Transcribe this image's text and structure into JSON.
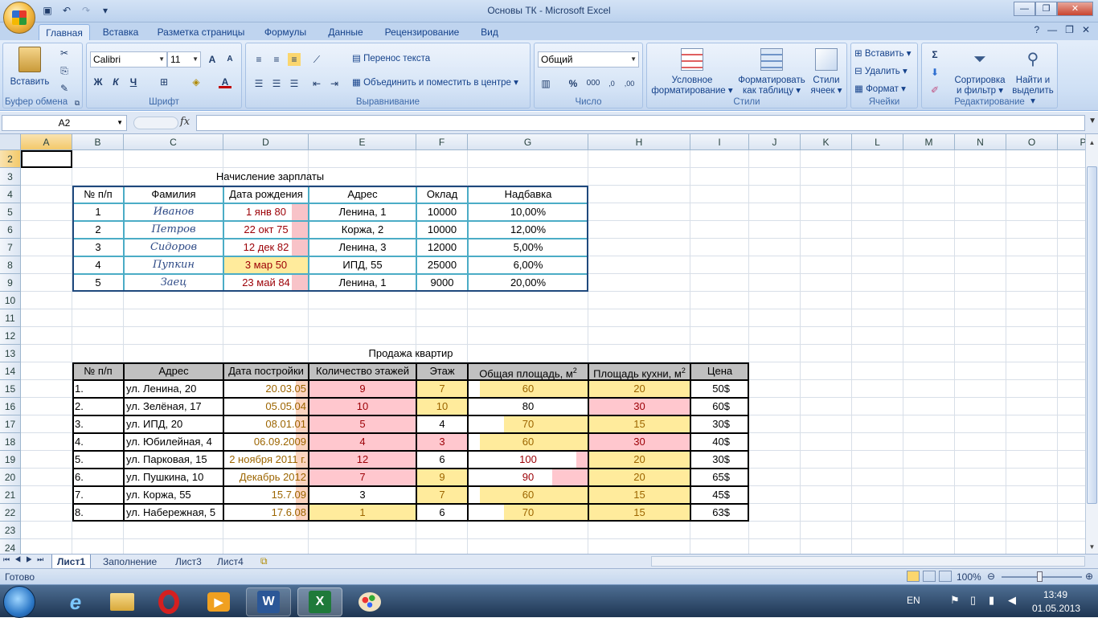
{
  "window": {
    "title": "Основы ТК - Microsoft Excel"
  },
  "tabs": [
    "Главная",
    "Вставка",
    "Разметка страницы",
    "Формулы",
    "Данные",
    "Рецензирование",
    "Вид"
  ],
  "ribbon": {
    "clipboard": {
      "label": "Буфер обмена",
      "paste": "Вставить"
    },
    "font": {
      "label": "Шрифт",
      "name": "Calibri",
      "size": "11"
    },
    "alignment": {
      "label": "Выравнивание",
      "wrap": "Перенос текста",
      "merge": "Объединить и поместить в центре"
    },
    "number": {
      "label": "Число",
      "format": "Общий"
    },
    "styles": {
      "label": "Стили",
      "cond1": "Условное",
      "cond2": "форматирование",
      "fmt1": "Форматировать",
      "fmt2": "как таблицу",
      "cell1": "Стили",
      "cell2": "ячеек"
    },
    "cells": {
      "label": "Ячейки",
      "insert": "Вставить",
      "delete": "Удалить",
      "format": "Формат"
    },
    "editing": {
      "label": "Редактирование",
      "sort1": "Сортировка",
      "sort2": "и фильтр",
      "find1": "Найти и",
      "find2": "выделить"
    }
  },
  "formula_bar": {
    "name_box": "A2",
    "fx": "fx",
    "formula": ""
  },
  "columns": [
    "A",
    "B",
    "C",
    "D",
    "E",
    "F",
    "G",
    "H",
    "I",
    "J",
    "K",
    "L",
    "M",
    "N",
    "O",
    "P"
  ],
  "rows": [
    "2",
    "3",
    "4",
    "5",
    "6",
    "7",
    "8",
    "9",
    "10",
    "11",
    "12",
    "13",
    "14",
    "15",
    "16",
    "17",
    "18",
    "19",
    "20",
    "21",
    "22",
    "23",
    "24"
  ],
  "salary": {
    "title": "Начисление зарплаты",
    "headers": [
      "№ п/п",
      "Фамилия",
      "Дата рождения",
      "Адрес",
      "Оклад",
      "Надбавка"
    ],
    "rows": [
      [
        "1",
        "Иванов",
        "1 янв 80",
        "Ленина, 1",
        "10000",
        "10,00%"
      ],
      [
        "2",
        "Петров",
        "22 окт 75",
        "Коржа, 2",
        "10000",
        "12,00%"
      ],
      [
        "3",
        "Сидоров",
        "12 дек 82",
        "Ленина, 3",
        "12000",
        "5,00%"
      ],
      [
        "4",
        "Пупкин",
        "3 мар 50",
        "ИПД, 55",
        "25000",
        "6,00%"
      ],
      [
        "5",
        "Заец",
        "23 май 84",
        "Ленина, 1",
        "9000",
        "20,00%"
      ]
    ]
  },
  "sales": {
    "title": "Продажа квартир",
    "headers": [
      "№ п/п",
      "Адрес",
      "Дата постройки",
      "Количество этажей",
      "Этаж",
      "Общая площадь, м",
      "Площадь кухни, м",
      "Цена"
    ],
    "sup": "2",
    "rows": [
      [
        "1.",
        "ул. Ленина, 20",
        "20.03.05",
        "9",
        "7",
        "60",
        "20",
        "50$"
      ],
      [
        "2.",
        "ул. Зелёная, 17",
        "05.05.04",
        "10",
        "10",
        "80",
        "30",
        "60$"
      ],
      [
        "3.",
        "ул. ИПД, 20",
        "08.01.01",
        "5",
        "4",
        "70",
        "15",
        "30$"
      ],
      [
        "4.",
        "ул. Юбилейная, 4",
        "06.09.2009",
        "4",
        "3",
        "60",
        "30",
        "40$"
      ],
      [
        "5.",
        "ул. Парковая, 15",
        "2 ноября 2011 г.",
        "12",
        "6",
        "100",
        "20",
        "30$"
      ],
      [
        "6.",
        "ул. Пушкина, 10",
        "Декабрь 2012",
        "7",
        "9",
        "90",
        "20",
        "65$"
      ],
      [
        "7.",
        "ул. Коржа, 55",
        "15.7.09",
        "3",
        "7",
        "60",
        "15",
        "45$"
      ],
      [
        "8.",
        "ул. Набережная, 5",
        "17.6.08",
        "1",
        "6",
        "70",
        "15",
        "63$"
      ]
    ]
  },
  "sheet_tabs": [
    "Лист1",
    "Заполнение",
    "Лист3",
    "Лист4"
  ],
  "status": {
    "ready": "Готово",
    "zoom": "100%"
  },
  "taskbar": {
    "lang": "EN",
    "time": "13:49",
    "date": "01.05.2013"
  }
}
